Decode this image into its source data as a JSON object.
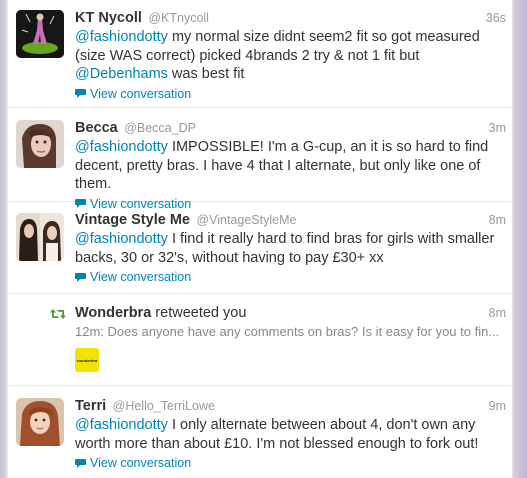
{
  "tweets": [
    {
      "fullname": "KT Nycoll",
      "username": "@KTnycoll",
      "time": "36s",
      "mention": "@fashiondotty",
      "text": " my normal size didnt seem2 fit so got measured (size WAS correct) picked 4brands 2 try & not 1 fit but ",
      "mention2": "@Debenhams",
      "text2": " was best fit",
      "view": "View conversation"
    },
    {
      "fullname": "Becca",
      "username": "@Becca_DP",
      "time": "3m",
      "mention": "@fashiondotty",
      "text": " IMPOSSIBLE! I'm a G-cup, an it is so hard to find decent, pretty bras. I have 4 that I alternate, but only like one of them.",
      "view": "View conversation"
    },
    {
      "fullname": "Vintage Style Me",
      "username": "@VintageStyleMe",
      "time": "8m",
      "mention": "@fashiondotty",
      "text": " I find it really hard to find bras for girls with smaller backs, 30 or 32's, without having to pay £30+ xx",
      "view": "View conversation"
    },
    {
      "fullname": "Terri",
      "username": "@Hello_TerriLowe",
      "time": "9m",
      "mention": "@fashiondotty",
      "text": " I only alternate between about 4, don't own any worth more than about £10. I'm not blessed enough to fork out!",
      "view": "View conversation"
    }
  ],
  "retweet": {
    "who": "Wonderbra",
    "action": " retweeted you",
    "time": "8m",
    "subtext": "12m: Does anyone have any comments on bras? Is it easy for you to fin...",
    "logo_text": "wonderbra"
  },
  "colors": {
    "link": "#0084b4",
    "retweet_green": "#5c913b",
    "logo_yellow": "#f2e200"
  }
}
